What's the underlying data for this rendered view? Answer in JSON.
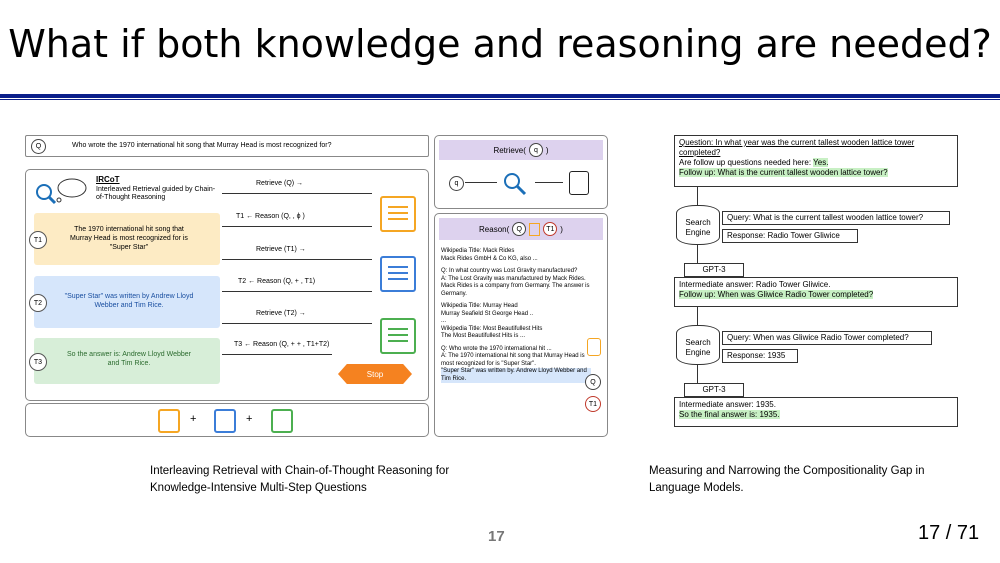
{
  "slide": {
    "title": "What if both knowledge and reasoning are needed?",
    "page_number": "17",
    "counter": "17 / 71"
  },
  "captions": {
    "left": "Interleaving Retrieval with Chain-of-Thought Reasoning for Knowledge-Intensive Multi-Step Questions",
    "right": "Measuring and Narrowing the Compositionality Gap in Language Models."
  },
  "ircot": {
    "q_marker": "Q",
    "question": "Who wrote the 1970 international hit song that Murray Head is most recognized for?",
    "name": "IRCoT",
    "subtitle": "Interleaved Retrieval guided by Chain-of-Thought Reasoning",
    "t1_label": "T1",
    "t1_text": "The 1970 international hit song that Murray Head is most recognized for is \"Super Star\"",
    "t2_label": "T2",
    "t2_text": "\"Super Star\" was written by Andrew Lloyd Webber and Tim Rice.",
    "t3_label": "T3",
    "t3_text": "So the answer is: Andrew Lloyd Webber and Tim Rice.",
    "steps": [
      "Retrieve (Q) →",
      "T1 ← Reason (Q, , ϕ )",
      "Retrieve (T1) →",
      "T2 ← Reason (Q, + , T1)",
      "Retrieve (T2) →",
      "T3 ← Reason (Q, + + , T1+T2)"
    ],
    "stop": "Stop",
    "plus": "+",
    "retrieve_title": "Retrieve(",
    "retrieve_q": "q",
    "retrieve_close": ")",
    "reason_title": "Reason(",
    "reason_q": "Q",
    "reason_t1": "T1",
    "reason_close": ")",
    "reason_lines": [
      "Wikipedia Title: Mack Rides",
      "Mack Rides GmbH & Co KG, also ...",
      "Q: In what country was Lost Gravity manufactured?",
      "A: The Lost Gravity was manufactured by Mack Rides. Mack Rides is a company from Germany. The answer is Germany.",
      "Wikipedia Title: Murray Head",
      "Murray Seafield St George Head ..",
      "...",
      "Wikipedia Title: Most Beautifullest Hits",
      "The Most Beautifullest Hits is ...",
      "Q: Who wrote the 1970 international hit ...",
      "A: The 1970 international hit song that Murray Head is most recognized for is \"Super Star\".",
      "\"Super Star\" was written by. Andrew Lloyd Webber and Tim Rice."
    ]
  },
  "selfask": {
    "q1": "Question: In what year was the current tallest wooden lattice tower completed?",
    "followup_needed": "Are follow up questions needed here:",
    "yes": "Yes.",
    "follow1": "Follow up: What is the current tallest wooden lattice tower?",
    "engine": "Search Engine",
    "query1": "Query: What is the current tallest wooden lattice tower?",
    "resp1": "Response: Radio Tower Gliwice",
    "gpt": "GPT-3",
    "inter1": "Intermediate answer: Radio Tower Gliwice.",
    "follow2": "Follow up: When was Gliwice Radio Tower completed?",
    "query2": "Query: When was Gliwice Radio Tower completed?",
    "resp2": "Response: 1935",
    "inter2": "Intermediate answer: 1935.",
    "final": "So the final answer is: 1935."
  },
  "colors": {
    "rule": "#0b1f8a",
    "orange": "#f5a623",
    "blue": "#3b7dd8",
    "green": "#4caf50",
    "t1_bg": "#fdebc4",
    "t2_bg": "#d6e6fb",
    "t3_bg": "#d7eed8",
    "highlight": "#c8f0c4"
  }
}
